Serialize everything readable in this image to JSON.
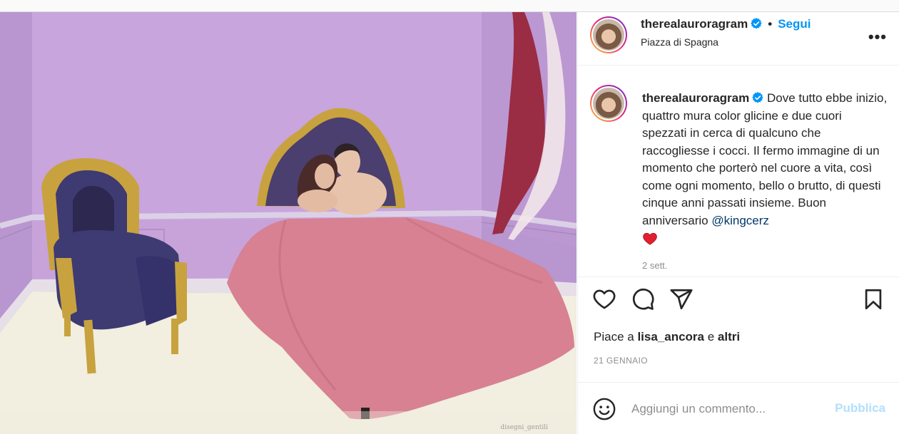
{
  "post": {
    "image_alt": "Illustration of a couple in a bed with a pink blanket in a lilac room next to a blue and gold armchair",
    "signature_text": "disegni_gentili",
    "colors": {
      "wall": "#c39ed8",
      "floor": "#f1eddf",
      "blanket": "#d87f93",
      "chair": "#3e3a72",
      "gold": "#c8a23e",
      "curtain": "#9a2c44"
    }
  },
  "header": {
    "username": "therealauroragram",
    "verified_icon": "verified-badge-icon",
    "separator": "•",
    "follow_label": "Segui",
    "location": "Piazza di Spagna",
    "more_label": "•••"
  },
  "caption": {
    "username": "therealauroragram",
    "text": "Dove tutto ebbe inizio, quattro mura color glicine e due cuori spezzati in cerca di qualcuno che raccogliesse i cocci. Il fermo immagine di un momento che porterò nel cuore a vita, così come ogni momento, bello o brutto, di questi cinque anni passati insieme. Buon anniversario ",
    "mention": "@kingcerz",
    "emoji": "red-heart-icon",
    "time": "2 sett."
  },
  "actions": {
    "like": "heart-icon",
    "comment": "comment-bubble-icon",
    "share": "paper-plane-icon",
    "save": "bookmark-icon"
  },
  "likes": {
    "prefix": "Piace a ",
    "user": "lisa_ancora",
    "joiner": " e ",
    "others": "altri"
  },
  "date": "21 GENNAIO",
  "comment": {
    "placeholder": "Aggiungi un commento...",
    "publish_label": "Pubblica",
    "emoji_icon": "smiley-icon"
  }
}
